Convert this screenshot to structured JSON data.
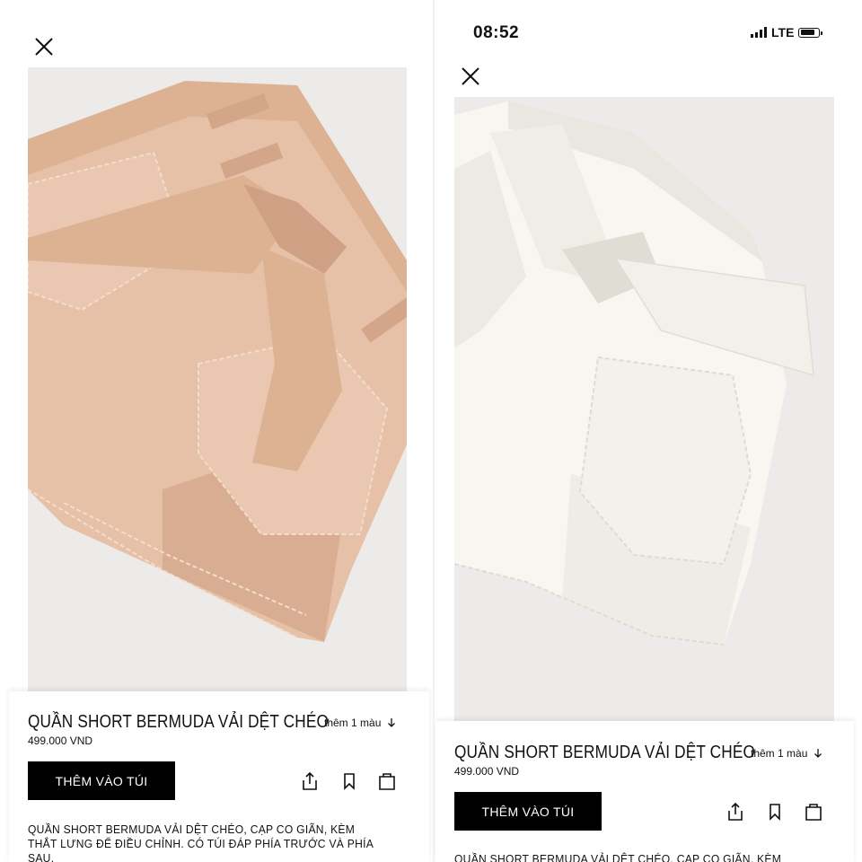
{
  "status": {
    "time": "08:52",
    "network": "LTE"
  },
  "product": {
    "name": "QUẦN SHORT BERMUDA VẢI DỆT CHÉO",
    "price": "499.000 VND",
    "more_colors": "thêm 1 màu",
    "add_to_bag": "THÊM VÀO TÚI",
    "description": "QUẦN SHORT BERMUDA VẢI DỆT CHÉO, CẠP CO GIÃN, KÈM THẮT LƯNG ĐỂ ĐIỀU CHỈNH. CÓ TÚI ĐÁP PHÍA TRƯỚC VÀ PHÍA SAU."
  },
  "variants": [
    {
      "color_name": "pink",
      "fabric": "#e6c1a7",
      "shade": "#cfa084",
      "stitch": "#f3ddcc"
    },
    {
      "color_name": "white",
      "fabric": "#f7f6f1",
      "shade": "#e0ddd5",
      "stitch": "#ffffff"
    }
  ],
  "icons": {
    "close": "close-icon",
    "share": "share-icon",
    "save": "bookmark-icon",
    "bag": "shopping-bag-icon",
    "arrow": "arrow-down-icon"
  },
  "colors": {
    "button_bg": "#000000",
    "button_text": "#ffffff",
    "photo_bg": "#ececea"
  }
}
